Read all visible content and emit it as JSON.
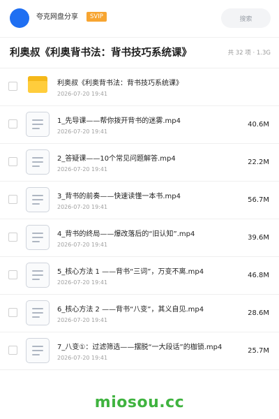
{
  "header": {
    "app_name": "夸克网盘分享",
    "badge": "SVIP",
    "search_placeholder": "搜索"
  },
  "share": {
    "title": "利奥叔《利奥背书法：背书技巧系统课》",
    "meta": "共 32 项 · 1.3G"
  },
  "files": [
    {
      "type": "folder",
      "name": "利奥叔《利奥背书法：背书技巧系统课》",
      "date": "2026-07-20 19:41",
      "size": ""
    },
    {
      "type": "file",
      "name": "1_先导课——帮你拨开背书的迷雾.mp4",
      "date": "2026-07-20 19:41",
      "size": "40.6M"
    },
    {
      "type": "file",
      "name": "2_答疑课——10个常见问题解答.mp4",
      "date": "2026-07-20 19:41",
      "size": "22.2M"
    },
    {
      "type": "file",
      "name": "3_背书的前奏——快速读懂一本书.mp4",
      "date": "2026-07-20 19:41",
      "size": "56.7M"
    },
    {
      "type": "file",
      "name": "4_背书的终局——爆改落后的“旧认知”.mp4",
      "date": "2026-07-20 19:41",
      "size": "39.6M"
    },
    {
      "type": "file",
      "name": "5_核心方法 1 ——背书“三词”，万变不离.mp4",
      "date": "2026-07-20 19:41",
      "size": "46.8M"
    },
    {
      "type": "file",
      "name": "6_核心方法 2 ——背书“八变”，其义自见.mp4",
      "date": "2026-07-20 19:41",
      "size": "28.6M"
    },
    {
      "type": "file",
      "name": "7_八变①：过滤筛选——摆脱“一大段话”的枷锁.mp4",
      "date": "2026-07-20 19:41",
      "size": "25.7M"
    }
  ],
  "watermark": "miosou.cc",
  "colors": {
    "avatar": "#1f6ff2",
    "badge": "#f7a531",
    "folder": "#ffcd3c",
    "watermark": "#3fb33f"
  },
  "icons": {
    "folder": "folder-icon",
    "file": "document-icon"
  }
}
